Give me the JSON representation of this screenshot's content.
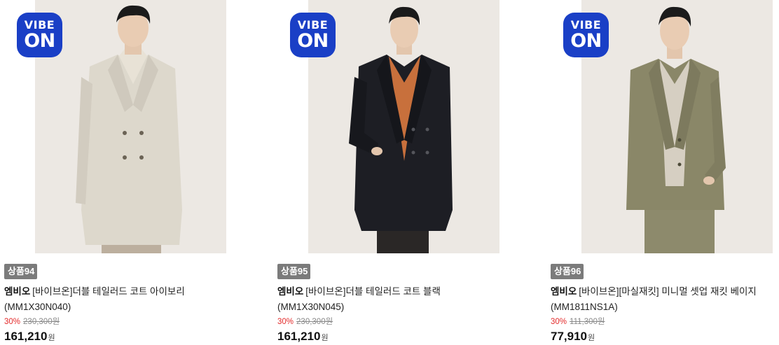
{
  "products": [
    {
      "badge_line1": "VIBE",
      "badge_line2": "ON",
      "tag": "상품94",
      "brand": "엠비오",
      "title": "[바이브온]더블 테일러드 코트 아이보리 (MM1X30N040)",
      "discount": "30%",
      "original_price": "230,300원",
      "price": "161,210",
      "currency": "원",
      "coat_color": "#ddd8cc",
      "inner_color": "#e8e2d6",
      "pants_color": "#bcaf9e"
    },
    {
      "badge_line1": "VIBE",
      "badge_line2": "ON",
      "tag": "상품95",
      "brand": "엠비오",
      "title": "[바이브온]더블 테일러드 코트 블랙 (MM1X30N045)",
      "discount": "30%",
      "original_price": "230,300원",
      "price": "161,210",
      "currency": "원",
      "coat_color": "#1d1e24",
      "inner_color": "#c8703c",
      "pants_color": "#2a2726"
    },
    {
      "badge_line1": "VIBE",
      "badge_line2": "ON",
      "tag": "상품96",
      "brand": "엠비오",
      "title": "[바이브온][마실재킷] 미니멀 셋업 재킷 베이지 (MM1811NS1A)",
      "discount": "30%",
      "original_price": "111,300원",
      "price": "77,910",
      "currency": "원",
      "coat_color": "#8a8768",
      "inner_color": "#d6cfc2",
      "pants_color": "#8d8a6c"
    }
  ],
  "colors": {
    "badge_bg": "#1a3fc6",
    "tag_bg": "#7b7b7b",
    "discount": "#e32b2b",
    "photo_bg": "#ece8e3"
  }
}
